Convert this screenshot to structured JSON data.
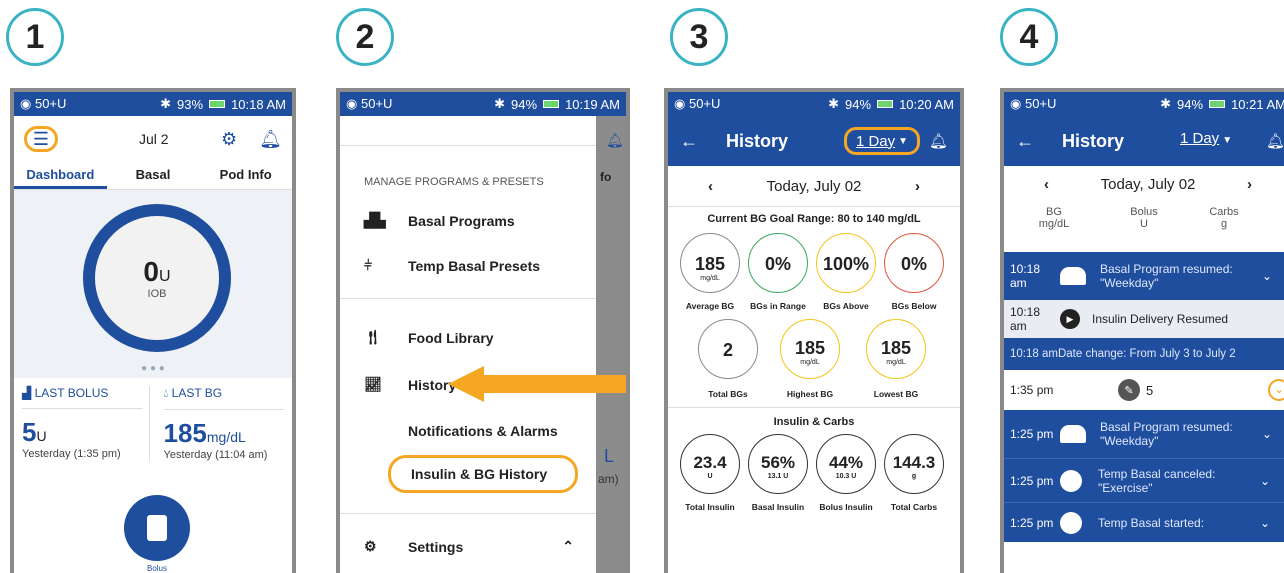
{
  "steps": [
    "1",
    "2",
    "3",
    "4"
  ],
  "status": {
    "p1": {
      "left": "50+U",
      "right": "93%",
      "time": "10:18 AM"
    },
    "p2": {
      "left": "50+U",
      "right": "94%",
      "time": "10:19 AM"
    },
    "p3": {
      "left": "50+U",
      "right": "94%",
      "time": "10:20 AM"
    },
    "p4": {
      "left": "50+U",
      "right": "94%",
      "time": "10:21 AM"
    }
  },
  "p1": {
    "date": "Jul 2",
    "tabs": [
      "Dashboard",
      "Basal",
      "Pod Info"
    ],
    "iob_value": "0",
    "iob_unit": "U",
    "iob_label": "IOB",
    "last_bolus_label": "LAST BOLUS",
    "last_bolus_value": "5",
    "last_bolus_unit": "U",
    "last_bolus_time": "Yesterday (1:35 pm)",
    "last_bg_label": "LAST BG",
    "last_bg_value": "185",
    "last_bg_unit": "mg/dL",
    "last_bg_time": "Yesterday (11:04 am)",
    "bolus_label": "Bolus"
  },
  "p2": {
    "section": "MANAGE PROGRAMS & PRESETS",
    "items": [
      "Basal Programs",
      "Temp Basal Presets",
      "Food Library",
      "History",
      "Notifications & Alarms",
      "Insulin & BG History",
      "Settings"
    ],
    "peek_fo": "fo",
    "peek_l": "L",
    "peek_am": "am)"
  },
  "p3": {
    "title": "History",
    "range": "1 Day",
    "date": "Today, July 02",
    "goal": "Current BG Goal Range: 80 to 140 mg/dL",
    "bg_stats": [
      {
        "value": "185",
        "unit": "mg/dL",
        "label": "Average BG",
        "color": "#8a8a8a"
      },
      {
        "value": "0%",
        "unit": "",
        "label": "BGs in Range",
        "color": "#3aaa5c"
      },
      {
        "value": "100%",
        "unit": "",
        "label": "BGs Above",
        "color": "#f5c518"
      },
      {
        "value": "0%",
        "unit": "",
        "label": "BGs Below",
        "color": "#e0553a"
      }
    ],
    "bg_stats2": [
      {
        "value": "2",
        "unit": "",
        "label": "Total BGs",
        "color": "#8a8a8a"
      },
      {
        "value": "185",
        "unit": "mg/dL",
        "label": "Highest BG",
        "color": "#f5c518"
      },
      {
        "value": "185",
        "unit": "mg/dL",
        "label": "Lowest BG",
        "color": "#f5c518"
      }
    ],
    "insulin_title": "Insulin & Carbs",
    "ins_stats": [
      {
        "value": "23.4",
        "unit": "U",
        "label": "Total Insulin"
      },
      {
        "value": "56%",
        "unit": "13.1 U",
        "label": "Basal Insulin"
      },
      {
        "value": "44%",
        "unit": "10.3 U",
        "label": "Bolus Insulin"
      },
      {
        "value": "144.3",
        "unit": "g",
        "label": "Total Carbs"
      }
    ]
  },
  "p4": {
    "title": "History",
    "range": "1 Day",
    "date": "Today, July 02",
    "col_bg": "BG",
    "col_bg_unit": "mg/dL",
    "col_bolus": "Bolus",
    "col_bolus_unit": "U",
    "col_carbs": "Carbs",
    "col_carbs_unit": "g",
    "rows": [
      {
        "time": "10:18 am",
        "text": "Basal Program resumed: \"Weekday\""
      },
      {
        "time": "10:18 am",
        "text": "Insulin Delivery Resumed"
      },
      {
        "time": "10:18 am",
        "text": "Date change: From July 3 to July 2"
      },
      {
        "time": "1:35 pm",
        "text": "5"
      },
      {
        "time": "1:25 pm",
        "text": "Basal Program resumed: \"Weekday\""
      },
      {
        "time": "1:25 pm",
        "text": "Temp Basal canceled: \"Exercise\""
      },
      {
        "time": "1:25 pm",
        "text": "Temp Basal started:"
      }
    ]
  }
}
